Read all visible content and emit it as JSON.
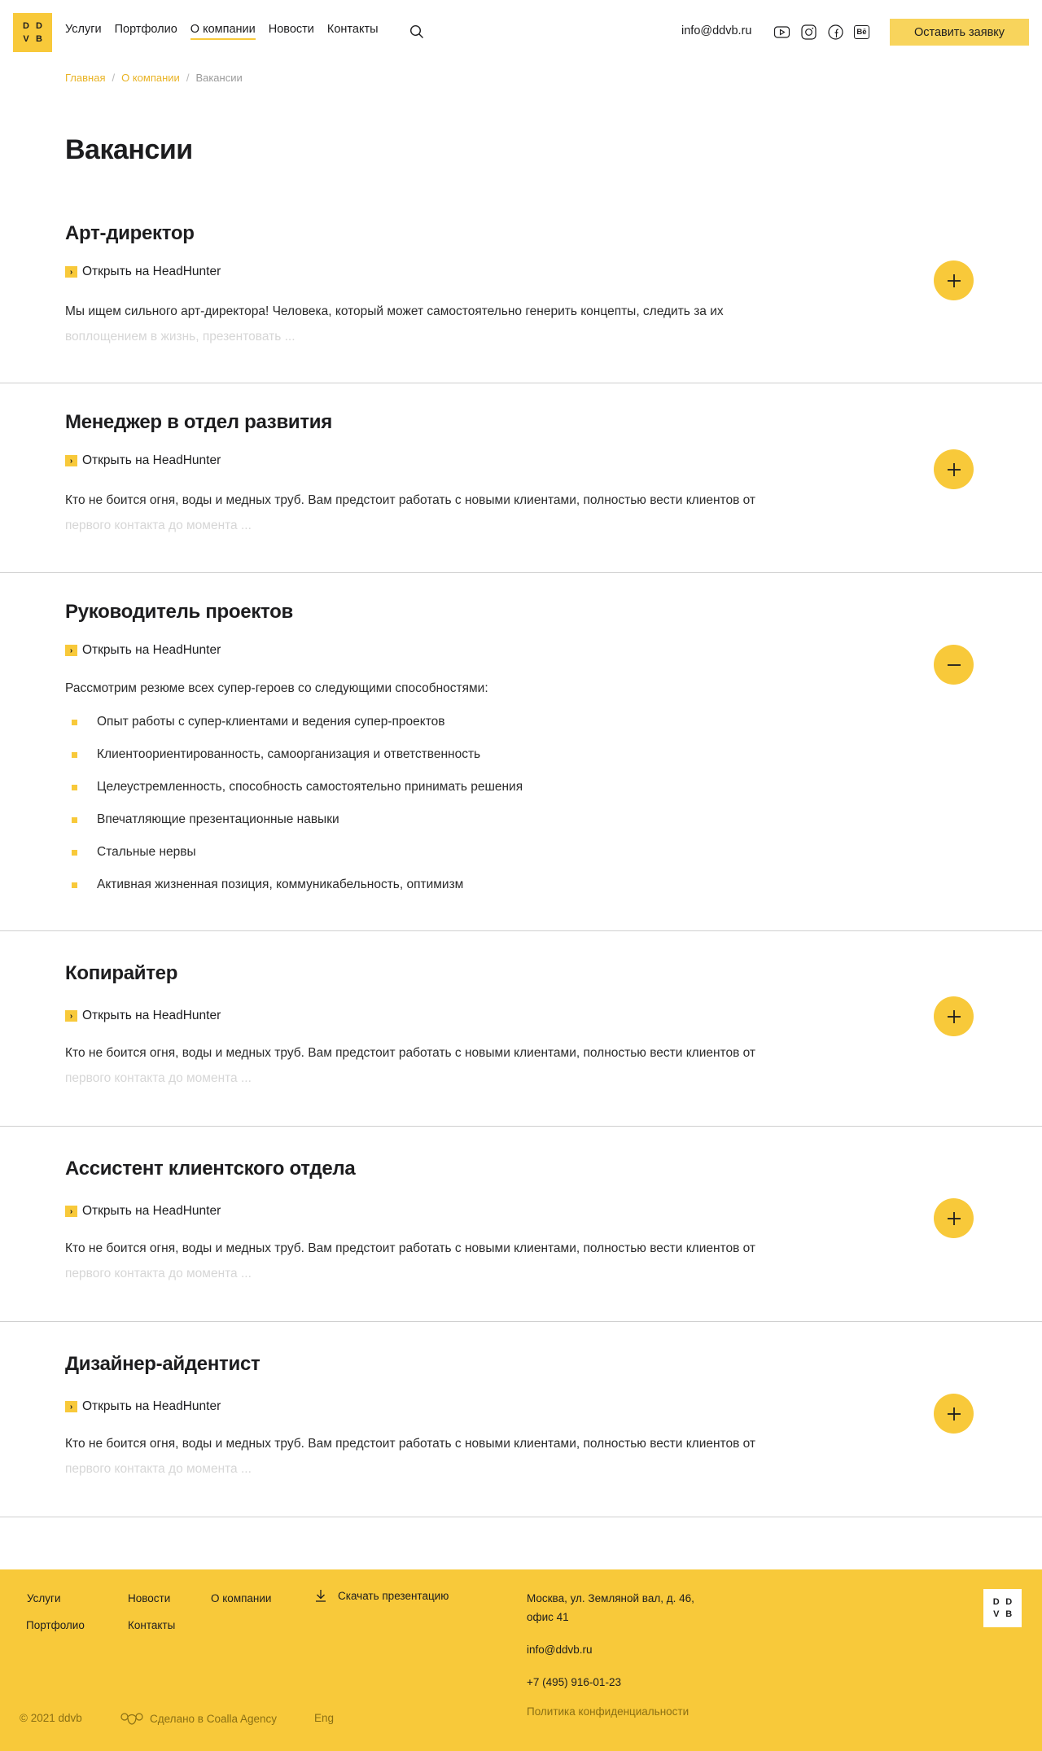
{
  "header": {
    "logo_letters": [
      "D",
      "D",
      "V",
      "B"
    ],
    "nav": [
      {
        "label": "Услуги"
      },
      {
        "label": "Портфолио"
      },
      {
        "label": "О компании"
      },
      {
        "label": "Новости"
      },
      {
        "label": "Контакты"
      }
    ],
    "email": "info@ddvb.ru",
    "socials": [
      "youtube-icon",
      "instagram-icon",
      "facebook-icon",
      "behance-icon"
    ],
    "behance_text": "Bē",
    "cta_label": "Оставить заявку",
    "accent_color": "#f8c93a"
  },
  "breadcrumb": {
    "home": "Главная",
    "about": "О компании",
    "current": "Вакансии",
    "separator": "/"
  },
  "page_title": "Вакансии",
  "vacancies": [
    {
      "title": "Арт-директор",
      "hh_label": "Открыть на HeadHunter",
      "hh_glyph": "›",
      "excerpt_lead": "Мы ищем сильного арт-директора! Человека, который может самостоятельно генерить концепты, следить за их",
      "excerpt_fade": "воплощением в жизнь, презентовать ..."
    },
    {
      "title": "Менеджер в отдел развития",
      "hh_label": "Открыть на HeadHunter",
      "hh_glyph": "›",
      "excerpt_lead": "Кто не боится огня, воды и медных труб. Вам предстоит работать с новыми клиентами, полностью вести клиентов от",
      "excerpt_fade": "первого контакта до момента ..."
    },
    {
      "title": "Руководитель проектов",
      "hh_label": "Открыть на HeadHunter",
      "hh_glyph": "›",
      "intro": "Рассмотрим резюме всех супер-героев со следующими способностями:",
      "requirements": [
        "Опыт работы с супер-клиентами и ведения супер-проектов",
        "Клиентоориентированность, самоорганизация и ответственность",
        "Целеустремленность, способность самостоятельно принимать решения",
        "Впечатляющие презентационные навыки",
        "Стальные нервы",
        "Активная жизненная позиция, коммуникабельность, оптимизм"
      ]
    },
    {
      "title": "Копирайтер",
      "hh_label": "Открыть на HeadHunter",
      "hh_glyph": "›",
      "excerpt_lead": "Кто не боится огня, воды и медных труб. Вам предстоит работать с новыми клиентами, полностью вести клиентов от",
      "excerpt_fade": "первого контакта до момента ..."
    },
    {
      "title": "Ассистент клиентского отдела",
      "hh_label": "Открыть на HeadHunter",
      "hh_glyph": "›",
      "excerpt_lead": "Кто не боится огня, воды и медных труб. Вам предстоит работать с новыми клиентами, полностью вести клиентов от",
      "excerpt_fade": "первого контакта до момента ..."
    },
    {
      "title": "Дизайнер-айдентист",
      "hh_label": "Открыть на HeadHunter",
      "hh_glyph": "›",
      "excerpt_lead": "Кто не боится огня, воды и медных труб. Вам предстоит работать с новыми клиентами, полностью вести клиентов от",
      "excerpt_fade": "первого контакта до момента ..."
    }
  ],
  "footer": {
    "links": {
      "services": "Услуги",
      "portfolio": "Портфолио",
      "news": "Новости",
      "contacts": "Контакты",
      "about": "О компании"
    },
    "download": "Скачать презентацию",
    "address_line1": "Москва, ул. Земляной вал, д. 46,",
    "address_line2": "офис 41",
    "email": "info@ddvb.ru",
    "phone": "+7 (495) 916-01-23",
    "privacy": "Политика конфиденциальности",
    "copyright": "© 2021 ddvb",
    "made_by": "Сделано в Coalla Agency",
    "lang": "Eng",
    "logo_letters": [
      "D",
      "D",
      "V",
      "B"
    ]
  }
}
